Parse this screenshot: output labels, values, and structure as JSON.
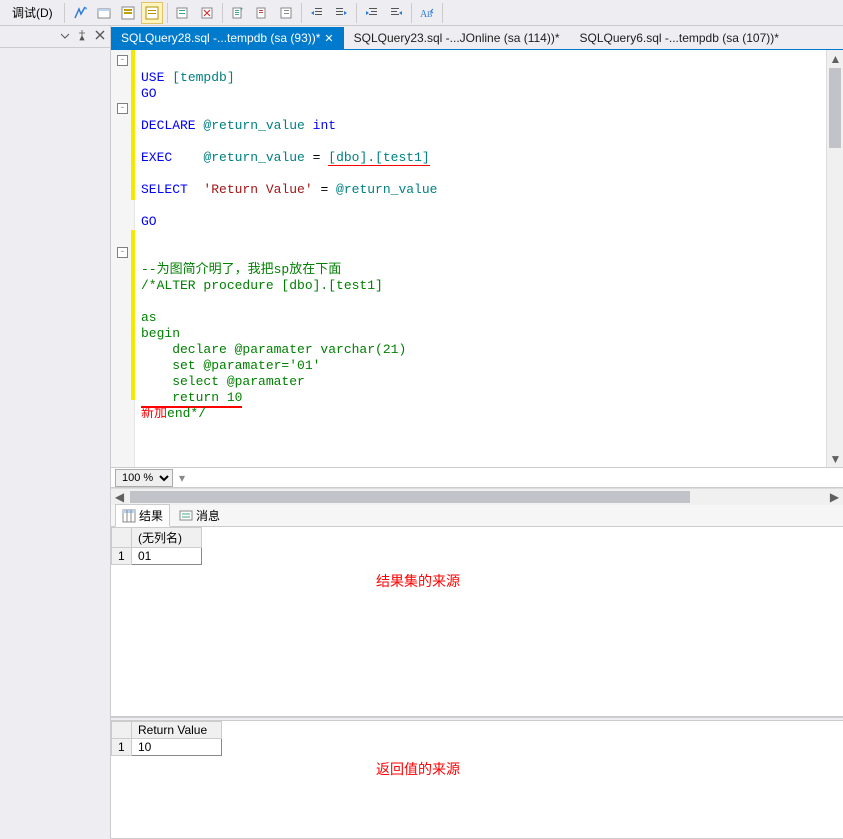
{
  "menu": {
    "debug": "调试(D)"
  },
  "tabs": [
    {
      "label": "SQLQuery28.sql -...tempdb (sa (93))*",
      "active": true
    },
    {
      "label": "SQLQuery23.sql -...JOnline (sa (114))*",
      "active": false
    },
    {
      "label": "SQLQuery6.sql -...tempdb (sa (107))*",
      "active": false
    }
  ],
  "zoom": {
    "value": "100 %"
  },
  "result_tabs": {
    "results": "结果",
    "messages": "消息"
  },
  "grid1": {
    "col_header": "(无列名)",
    "row_header": "1",
    "value": "01"
  },
  "grid2": {
    "col_header": "Return Value",
    "row_header": "1",
    "value": "10"
  },
  "code": {
    "l1_use": "USE",
    "l1_db": "[tempdb]",
    "l2_go": "GO",
    "l3_declare": "DECLARE",
    "l3_var": "@return_value",
    "l3_type": "int",
    "l4_exec": "EXEC",
    "l4_var": "@return_value",
    "l4_eq": " = ",
    "l4_target": "[dbo].[test1]",
    "l5_select": "SELECT",
    "l5_str": "'Return Value'",
    "l5_eq": " = ",
    "l5_var": "@return_value",
    "l6_go": "GO",
    "c1": "--为图简介明了，我把sp放在下面",
    "c2": "/*ALTER procedure [dbo].[test1]",
    "c3": "as",
    "c4": "begin",
    "c5": "    declare @paramater varchar(21)",
    "c6": "    set @paramater='01'",
    "c7": "    select @paramater",
    "c8": "    return 10",
    "c9": "end*/",
    "newadd": "新加"
  },
  "labels": {
    "source_resultset": "结果集的来源",
    "source_return": "返回值的来源"
  }
}
